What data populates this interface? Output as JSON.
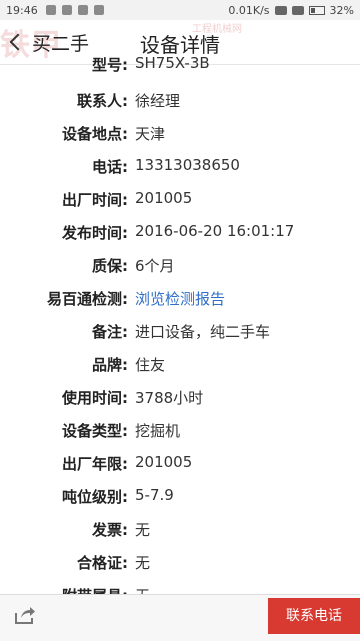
{
  "status_bar": {
    "time": "19:46",
    "network_speed": "0.01K/s",
    "battery": "32%"
  },
  "header": {
    "back_label": "买二手",
    "title": "设备详情",
    "watermark": "铁甲",
    "watermark_sub": "工程机械网"
  },
  "details": [
    {
      "label": "型号:",
      "value": "SH75X-3B"
    },
    {
      "label": "联系人:",
      "value": "徐经理"
    },
    {
      "label": "设备地点:",
      "value": "天津"
    },
    {
      "label": "电话:",
      "value": "13313038650"
    },
    {
      "label": "出厂时间:",
      "value": "201005"
    },
    {
      "label": "发布时间:",
      "value": "2016-06-20 16:01:17"
    },
    {
      "label": "质保:",
      "value": "6个月"
    },
    {
      "label": "易百通检测:",
      "value": "浏览检测报告"
    },
    {
      "label": "备注:",
      "value": "进口设备，纯二手车"
    },
    {
      "label": "品牌:",
      "value": "住友"
    },
    {
      "label": "使用时间:",
      "value": "3788小时"
    },
    {
      "label": "设备类型:",
      "value": "挖掘机"
    },
    {
      "label": "出厂年限:",
      "value": "201005"
    },
    {
      "label": "吨位级别:",
      "value": "5-7.9"
    },
    {
      "label": "发票:",
      "value": "无"
    },
    {
      "label": "合格证:",
      "value": "无"
    },
    {
      "label": "附带属具:",
      "value": "无"
    }
  ],
  "bottom": {
    "contact_label": "联系电话"
  },
  "colors": {
    "accent_red": "#d83a32",
    "link_blue": "#2f6fc9"
  }
}
